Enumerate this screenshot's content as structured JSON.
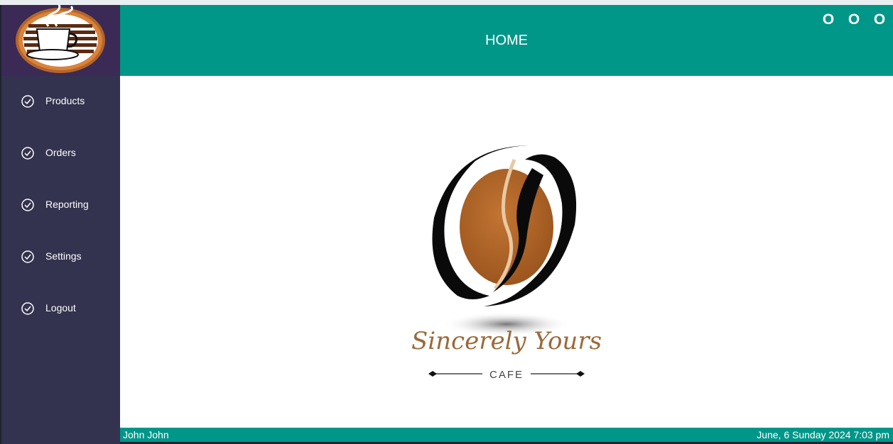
{
  "header": {
    "title": "HOME"
  },
  "window_controls": [
    "O",
    "O",
    "O"
  ],
  "sidebar": {
    "items": [
      {
        "label": "Products",
        "icon": "check-circle-icon"
      },
      {
        "label": "Orders",
        "icon": "check-circle-icon"
      },
      {
        "label": "Reporting",
        "icon": "check-circle-icon"
      },
      {
        "label": "Settings",
        "icon": "check-circle-icon"
      },
      {
        "label": "Logout",
        "icon": "check-circle-icon"
      }
    ]
  },
  "brand": {
    "script": "Sincerely Yours",
    "subtitle": "CAFE"
  },
  "footer": {
    "user": "John  John",
    "datetime": "June, 6 Sunday 2024 7:03 pm"
  },
  "colors": {
    "accent": "#009688",
    "sidebar": "#33334f",
    "logo_bg": "#3a2a55",
    "coffee": "#b5652a"
  }
}
